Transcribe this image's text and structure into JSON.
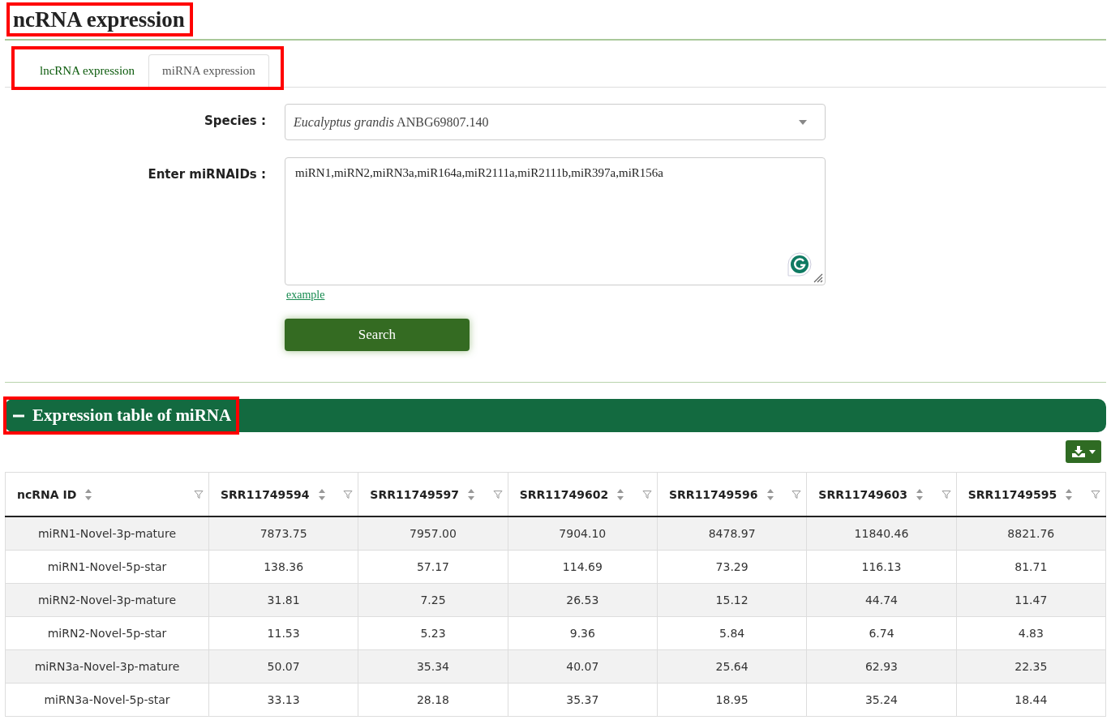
{
  "page_title": {
    "text": "ncRNA expression",
    "highlighted": true
  },
  "tabs": {
    "highlighted": true,
    "items": [
      {
        "label": "lncRNA expression",
        "selected": false
      },
      {
        "label": "miRNA expression",
        "selected": true
      }
    ]
  },
  "form": {
    "species_label": "Species :",
    "species_value": "*Eucalyptus grandis* ANBG69807.140",
    "ids_label": "Enter miRNAIDs :",
    "ids_value": "miRN1,miRN2,miRN3a,miR164a,miR2111a,miR2111b,miR397a,miR156a",
    "example_link": "example",
    "search_button": "Search"
  },
  "section": {
    "title": "Expression table of miRNA",
    "expanded": true,
    "highlighted": true
  },
  "table": {
    "columns": [
      "ncRNA ID",
      "SRR11749594",
      "SRR11749597",
      "SRR11749602",
      "SRR11749596",
      "SRR11749603",
      "SRR11749595"
    ],
    "rows": [
      [
        "miRN1-Novel-3p-mature",
        "7873.75",
        "7957.00",
        "7904.10",
        "8478.97",
        "11840.46",
        "8821.76"
      ],
      [
        "miRN1-Novel-5p-star",
        "138.36",
        "57.17",
        "114.69",
        "73.29",
        "116.13",
        "81.71"
      ],
      [
        "miRN2-Novel-3p-mature",
        "31.81",
        "7.25",
        "26.53",
        "15.12",
        "44.74",
        "11.47"
      ],
      [
        "miRN2-Novel-5p-star",
        "11.53",
        "5.23",
        "9.36",
        "5.84",
        "6.74",
        "4.83"
      ],
      [
        "miRN3a-Novel-3p-mature",
        "50.07",
        "35.34",
        "40.07",
        "25.64",
        "62.93",
        "22.35"
      ],
      [
        "miRN3a-Novel-5p-star",
        "33.13",
        "28.18",
        "35.37",
        "18.95",
        "35.24",
        "18.44"
      ]
    ]
  }
}
